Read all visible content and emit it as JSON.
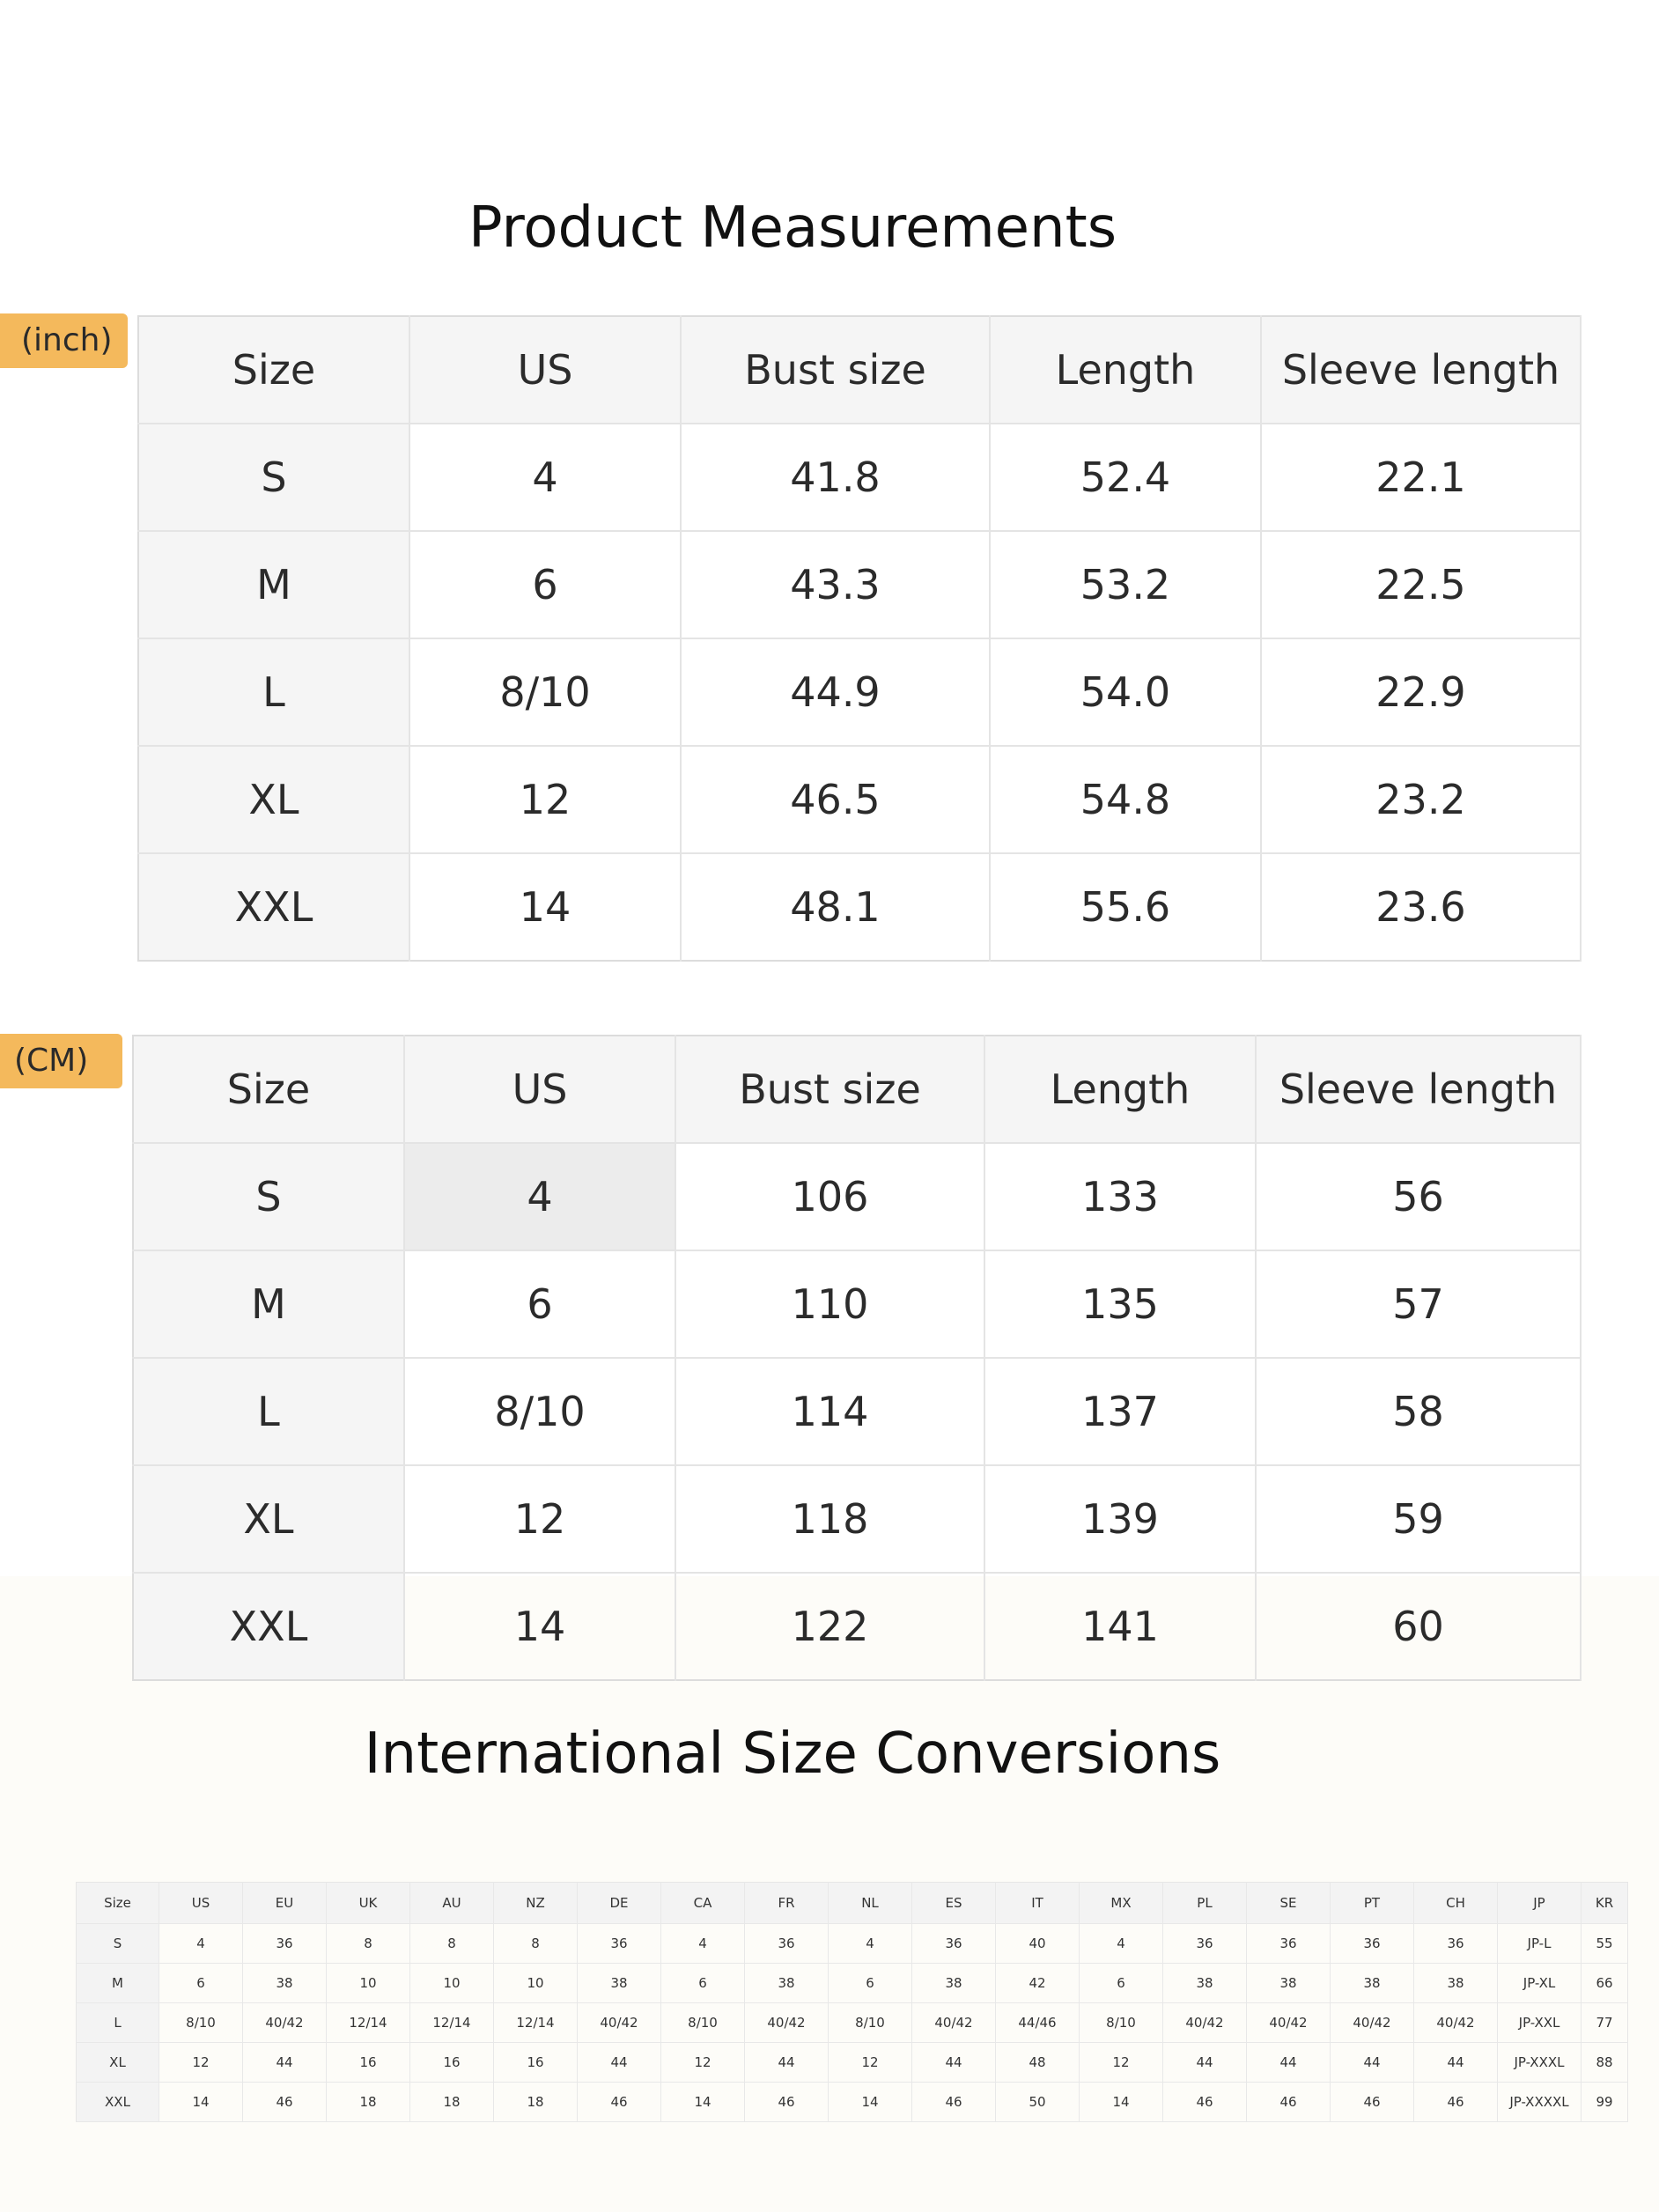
{
  "title_measurements": "Product Measurements",
  "title_conversions": "International Size Conversions",
  "units": {
    "inch": "(inch)",
    "cm": "(CM)"
  },
  "measurement_headers": [
    "Size",
    "US",
    "Bust size",
    "Length",
    "Sleeve length"
  ],
  "inch_rows": [
    [
      "S",
      "4",
      "41.8",
      "52.4",
      "22.1"
    ],
    [
      "M",
      "6",
      "43.3",
      "53.2",
      "22.5"
    ],
    [
      "L",
      "8/10",
      "44.9",
      "54.0",
      "22.9"
    ],
    [
      "XL",
      "12",
      "46.5",
      "54.8",
      "23.2"
    ],
    [
      "XXL",
      "14",
      "48.1",
      "55.6",
      "23.6"
    ]
  ],
  "cm_rows": [
    [
      "S",
      "4",
      "106",
      "133",
      "56"
    ],
    [
      "M",
      "6",
      "110",
      "135",
      "57"
    ],
    [
      "L",
      "8/10",
      "114",
      "137",
      "58"
    ],
    [
      "XL",
      "12",
      "118",
      "139",
      "59"
    ],
    [
      "XXL",
      "14",
      "122",
      "141",
      "60"
    ]
  ],
  "conversion_headers": [
    "Size",
    "US",
    "EU",
    "UK",
    "AU",
    "NZ",
    "DE",
    "CA",
    "FR",
    "NL",
    "ES",
    "IT",
    "MX",
    "PL",
    "SE",
    "PT",
    "CH",
    "JP",
    "KR"
  ],
  "conversion_rows": [
    [
      "S",
      "4",
      "36",
      "8",
      "8",
      "8",
      "36",
      "4",
      "36",
      "4",
      "36",
      "40",
      "4",
      "36",
      "36",
      "36",
      "36",
      "JP-L",
      "55"
    ],
    [
      "M",
      "6",
      "38",
      "10",
      "10",
      "10",
      "38",
      "6",
      "38",
      "6",
      "38",
      "42",
      "6",
      "38",
      "38",
      "38",
      "38",
      "JP-XL",
      "66"
    ],
    [
      "L",
      "8/10",
      "40/42",
      "12/14",
      "12/14",
      "12/14",
      "40/42",
      "8/10",
      "40/42",
      "8/10",
      "40/42",
      "44/46",
      "8/10",
      "40/42",
      "40/42",
      "40/42",
      "40/42",
      "JP-XXL",
      "77"
    ],
    [
      "XL",
      "12",
      "44",
      "16",
      "16",
      "16",
      "44",
      "12",
      "44",
      "12",
      "44",
      "48",
      "12",
      "44",
      "44",
      "44",
      "44",
      "JP-XXXL",
      "88"
    ],
    [
      "XXL",
      "14",
      "46",
      "18",
      "18",
      "18",
      "46",
      "14",
      "46",
      "14",
      "46",
      "50",
      "14",
      "46",
      "46",
      "46",
      "46",
      "JP-XXXXL",
      "99"
    ]
  ]
}
